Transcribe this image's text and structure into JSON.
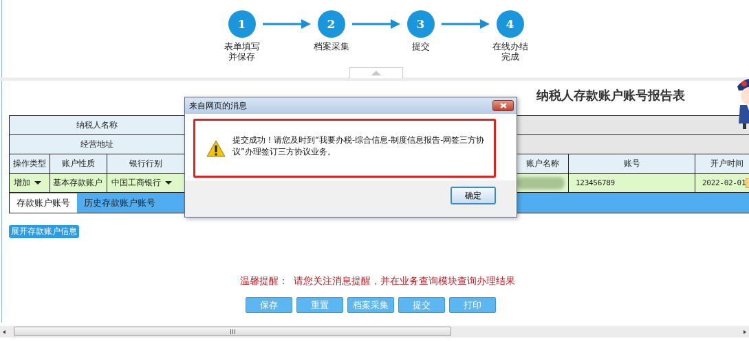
{
  "steps": [
    {
      "number": "1",
      "label": "表单填写并保存"
    },
    {
      "number": "2",
      "label": "档案采集"
    },
    {
      "number": "3",
      "label": "提交"
    },
    {
      "number": "4",
      "label": "在线办结完成"
    }
  ],
  "form": {
    "title": "纳税人存款账户账号报告表",
    "fields": [
      {
        "label": "纳税人名称"
      },
      {
        "label": "经营地址"
      }
    ],
    "columns": [
      "操作类型",
      "账户性质",
      "银行行别",
      "账户名称",
      "账号",
      "开户时间"
    ],
    "rows": [
      {
        "operation": "增加",
        "account_type": "基本存款账户",
        "bank": "中国工商银行",
        "account_name_blurred": true,
        "account_number": "123456789",
        "opened": "2022-02-01"
      }
    ],
    "tabs": [
      {
        "label": "存款账户账号",
        "selected": true
      },
      {
        "label": "历史存款账户账号",
        "selected": false
      }
    ]
  },
  "expand_button": "展开存款账户信息",
  "reminder": {
    "label": "温馨提醒：",
    "text": "请您关注消息提醒，并在业务查询模块查询办理结果"
  },
  "buttons": [
    "保存",
    "重置",
    "档案采集",
    "提交",
    "打印"
  ],
  "dialog": {
    "title": "来自网页的消息",
    "message": "提交成功！请您及时到“我要办税-综合信息-制度信息报告-网签三方协议”办理签订三方协议业务。",
    "highlighted": true,
    "ok_button": "确定"
  }
}
